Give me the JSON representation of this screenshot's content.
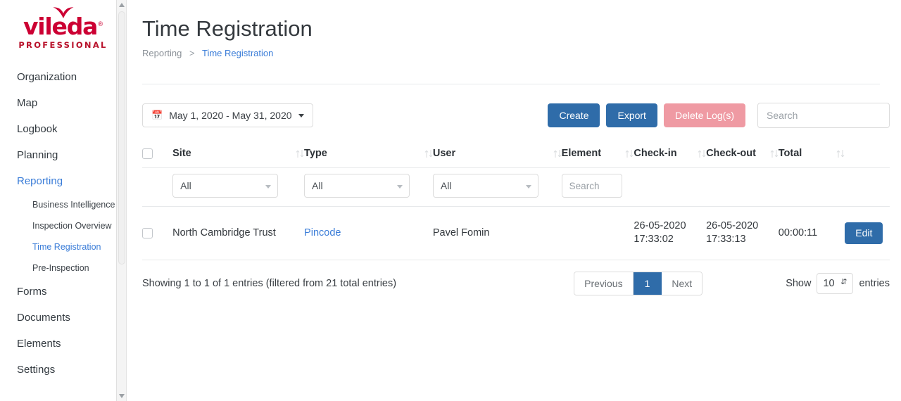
{
  "brand": {
    "name": "vileda",
    "registered": "®",
    "subtitle": "PROFESSIONAL",
    "color": "#cc0033"
  },
  "sidebar": {
    "items": [
      {
        "label": "Organization",
        "active": false
      },
      {
        "label": "Map",
        "active": false
      },
      {
        "label": "Logbook",
        "active": false
      },
      {
        "label": "Planning",
        "active": false
      },
      {
        "label": "Reporting",
        "active": true
      },
      {
        "label": "Forms",
        "active": false
      },
      {
        "label": "Documents",
        "active": false
      },
      {
        "label": "Elements",
        "active": false
      },
      {
        "label": "Settings",
        "active": false
      }
    ],
    "subitems": [
      {
        "label": "Business Intelligence",
        "active": false
      },
      {
        "label": "Inspection Overview",
        "active": false
      },
      {
        "label": "Time Registration",
        "active": true
      },
      {
        "label": "Pre-Inspection",
        "active": false
      }
    ]
  },
  "header": {
    "title": "Time Registration",
    "breadcrumb": {
      "parent": "Reporting",
      "separator": ">",
      "current": "Time Registration"
    }
  },
  "toolbar": {
    "date_range": "May 1, 2020 - May 31, 2020",
    "calendar_icon": "calendar-icon",
    "create_label": "Create",
    "export_label": "Export",
    "delete_label": "Delete Log(s)",
    "search_placeholder": "Search",
    "search_value": "",
    "primary_color": "#2f6ca9",
    "danger_color": "#ef9aa3"
  },
  "table": {
    "columns": [
      {
        "label": "Site",
        "sortable": true
      },
      {
        "label": "Type",
        "sortable": true
      },
      {
        "label": "User",
        "sortable": true
      },
      {
        "label": "Element",
        "sortable": true
      },
      {
        "label": "Check-in",
        "sortable": true
      },
      {
        "label": "Check-out",
        "sortable": true
      },
      {
        "label": "Total",
        "sortable": true
      }
    ],
    "filters": {
      "site": "All",
      "type": "All",
      "user": "All",
      "element_placeholder": "Search",
      "element_value": ""
    },
    "rows": [
      {
        "site": "North Cambridge Trust",
        "type": "Pincode",
        "user": "Pavel Fomin",
        "element": "",
        "checkin_date": "26-05-2020",
        "checkin_time": "17:33:02",
        "checkout_date": "26-05-2020",
        "checkout_time": "17:33:13",
        "total": "00:00:11",
        "action_label": "Edit"
      }
    ]
  },
  "footer": {
    "showing": "Showing 1 to 1 of 1 entries (filtered from 21 total entries)",
    "previous_label": "Previous",
    "current_page": "1",
    "next_label": "Next",
    "show_label": "Show",
    "page_size": "10",
    "entries_label": "entries"
  }
}
